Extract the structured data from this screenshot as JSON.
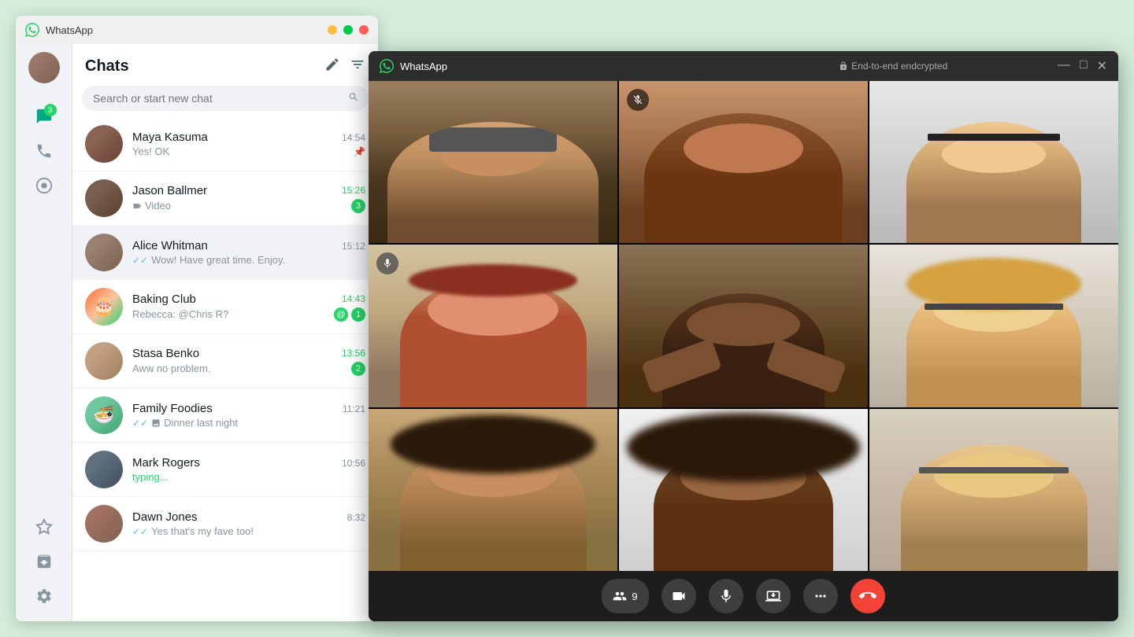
{
  "mainWindow": {
    "title": "WhatsApp",
    "titleBar": {
      "minimize": "—",
      "maximize": "□",
      "close": "✕"
    }
  },
  "sidebar": {
    "badge": "3",
    "items": [
      {
        "name": "menu",
        "icon": "☰"
      },
      {
        "name": "chats",
        "icon": "💬",
        "active": true,
        "badge": "3"
      },
      {
        "name": "calls",
        "icon": "📞"
      },
      {
        "name": "status",
        "icon": "⊙"
      },
      {
        "name": "starred",
        "icon": "☆"
      },
      {
        "name": "archived",
        "icon": "🗄"
      },
      {
        "name": "settings",
        "icon": "⚙"
      }
    ]
  },
  "chatsPanel": {
    "title": "Chats",
    "newChatIcon": "✏",
    "filterIcon": "≡",
    "search": {
      "placeholder": "Search or start new chat",
      "icon": "🔍"
    },
    "conversations": [
      {
        "id": "maya",
        "name": "Maya Kasuma",
        "time": "14:54",
        "preview": "Yes! OK",
        "pinned": true,
        "hasDoubleCheck": false,
        "unreadCount": 0
      },
      {
        "id": "jason",
        "name": "Jason Ballmer",
        "time": "15:26",
        "preview": "Video",
        "hasVideo": true,
        "unreadCount": 3,
        "timeGreen": true
      },
      {
        "id": "alice",
        "name": "Alice Whitman",
        "time": "15:12",
        "preview": "Wow! Have great time. Enjoy.",
        "hasDoubleCheck": true,
        "unreadCount": 0,
        "active": true
      },
      {
        "id": "baking",
        "name": "Baking Club",
        "time": "14:43",
        "preview": "Rebecca: @Chris R?",
        "hasMention": true,
        "unreadCount": 1,
        "timeGreen": true,
        "emoji": "🎂"
      },
      {
        "id": "stasa",
        "name": "Stasa Benko",
        "time": "13:56",
        "preview": "Aww no problem.",
        "unreadCount": 2,
        "timeGreen": true
      },
      {
        "id": "family",
        "name": "Family Foodies",
        "time": "11:21",
        "preview": "Dinner last night",
        "hasDoubleCheck": true,
        "hasMedia": true,
        "unreadCount": 0,
        "emoji": "🍜"
      },
      {
        "id": "mark",
        "name": "Mark Rogers",
        "time": "10:56",
        "preview": "typing...",
        "isTyping": true,
        "unreadCount": 0
      },
      {
        "id": "dawn",
        "name": "Dawn Jones",
        "time": "8:32",
        "preview": "Yes that's my fave too!",
        "hasDoubleCheck": true,
        "unreadCount": 0
      }
    ]
  },
  "videoCall": {
    "appName": "WhatsApp",
    "encryption": "End-to-end endcrypted",
    "participantCount": "9",
    "controls": {
      "participants": "9",
      "video": "📹",
      "mic": "🎤",
      "screen": "📤",
      "more": "•••",
      "endCall": "📞"
    }
  }
}
